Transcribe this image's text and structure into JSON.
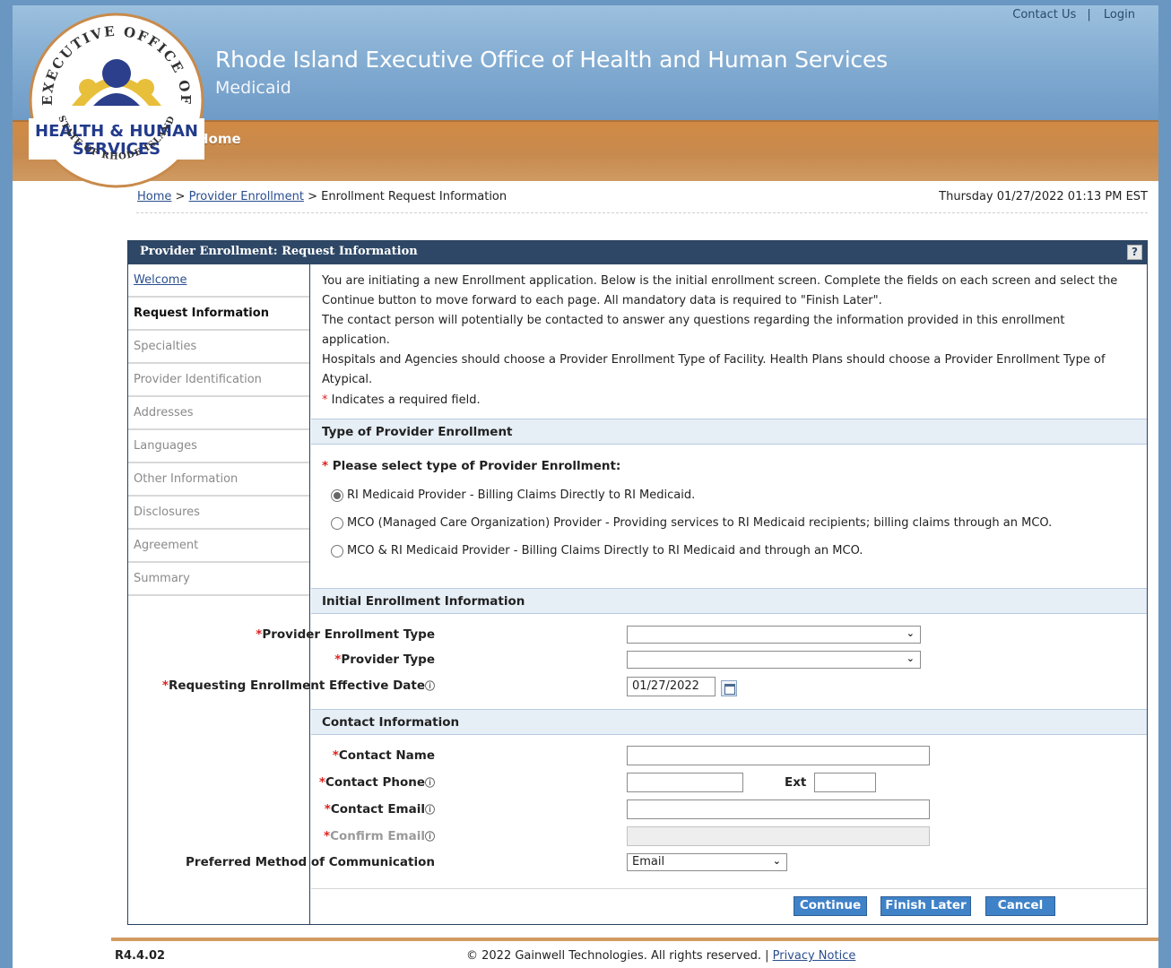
{
  "header": {
    "title": "Rhode Island Executive Office of Health and Human Services",
    "subtitle": "Medicaid",
    "contact_us": "Contact Us",
    "separator": "|",
    "login": "Login",
    "nav_home": "Home",
    "logo": {
      "arc_top": "EXECUTIVE OFFICE OF",
      "line1": "HEALTH & HUMAN",
      "line2": "SERVICES",
      "arc_bottom": "STATE OF RHODE ISLAND"
    }
  },
  "breadcrumb": {
    "home": "Home",
    "sep": ">",
    "provider_enrollment": "Provider Enrollment",
    "current": "Enrollment Request Information",
    "datetime": "Thursday 01/27/2022 01:13 PM EST"
  },
  "panel": {
    "title": "Provider Enrollment: Request Information",
    "help": "?"
  },
  "sidebar": {
    "items": [
      {
        "label": "Welcome"
      },
      {
        "label": "Request Information"
      },
      {
        "label": "Specialties"
      },
      {
        "label": "Provider Identification"
      },
      {
        "label": "Addresses"
      },
      {
        "label": "Languages"
      },
      {
        "label": "Other Information"
      },
      {
        "label": "Disclosures"
      },
      {
        "label": "Agreement"
      },
      {
        "label": "Summary"
      }
    ]
  },
  "intro": {
    "line1": "You are initiating a new Enrollment application. Below is the initial enrollment screen. Complete the fields on each screen and select the Continue button to move forward to each page. All mandatory data is required to \"Finish Later\".",
    "line2": "The contact person will potentially be contacted to answer any questions regarding the information provided in this enrollment application.",
    "line3": "Hospitals and Agencies should choose a Provider Enrollment Type of Facility. Health Plans should choose a Provider Enrollment Type of Atypical.",
    "required_star": "*",
    "required_note": "Indicates a required field."
  },
  "type_section": {
    "heading": "Type of Provider Enrollment",
    "question": "Please select type of Provider Enrollment:",
    "options": [
      {
        "label": "RI Medicaid Provider - Billing Claims Directly to RI Medicaid."
      },
      {
        "label": "MCO (Managed Care Organization) Provider - Providing services to RI Medicaid recipients; billing claims through an MCO."
      },
      {
        "label": "MCO & RI Medicaid Provider - Billing Claims Directly to RI Medicaid and through an MCO."
      }
    ],
    "selected_index": 0
  },
  "initial_section": {
    "heading": "Initial Enrollment Information",
    "enrollment_type_label": "Provider Enrollment Type",
    "enrollment_type_value": "",
    "provider_type_label": "Provider Type",
    "provider_type_value": "",
    "effective_date_label": "Requesting Enrollment Effective Date",
    "effective_date_value": "01/27/2022"
  },
  "contact_section": {
    "heading": "Contact Information",
    "name_label": "Contact Name",
    "name_value": "",
    "phone_label": "Contact Phone",
    "phone_value": "",
    "ext_label": "Ext",
    "ext_value": "",
    "email_label": "Contact Email",
    "email_value": "",
    "confirm_label": "Confirm Email",
    "confirm_value": "",
    "method_label": "Preferred Method of Communication",
    "method_value": "Email"
  },
  "buttons": {
    "continue": "Continue",
    "finish_later": "Finish Later",
    "cancel": "Cancel"
  },
  "footer": {
    "version": "R4.4.02",
    "copyright": "© 2022 Gainwell Technologies. All rights reserved. |",
    "privacy": "Privacy Notice"
  },
  "icons": {
    "info": "info-icon",
    "calendar": "calendar-icon",
    "dropdown": "chevron-down-icon"
  }
}
